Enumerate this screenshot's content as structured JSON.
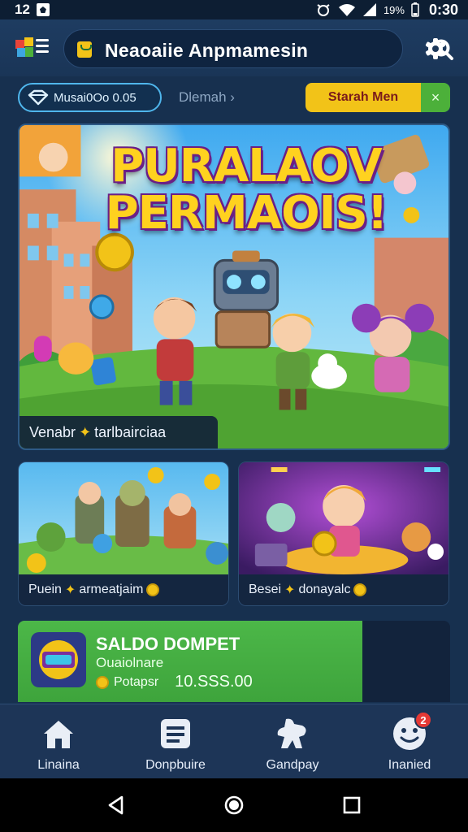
{
  "status_bar": {
    "left_text": "12",
    "battery_text": "19%",
    "time": "0:30"
  },
  "header": {
    "title": "Neaoaiie Anpmamesin"
  },
  "chips": {
    "primary_label": "Musai0Oo 0.05",
    "secondary_label": "Dlemah ›",
    "cta_label": "Starah Men",
    "cta_close": "×"
  },
  "hero": {
    "title_line1": "PURALAOV",
    "title_line2": "PERMAOIS!",
    "caption_prefix": "Venabr",
    "caption_suffix": "tarlbairciaa"
  },
  "cards": [
    {
      "prefix": "Puein",
      "suffix": "armeatjaim"
    },
    {
      "prefix": "Besei",
      "suffix": "donayalc"
    }
  ],
  "wallet": {
    "title": "SALDO DOMPET",
    "subtitle": "Ouaiolnare",
    "balance_label": "Potapsr",
    "balance_value": "10.SSS.00",
    "colors": {
      "green": "#46ad42"
    }
  },
  "bottom_nav": [
    {
      "label": "Linaina",
      "icon": "home-icon"
    },
    {
      "label": "Donpbuire",
      "icon": "document-icon"
    },
    {
      "label": "Gandpay",
      "icon": "puzzle-icon"
    },
    {
      "label": "Inanied",
      "icon": "profile-icon",
      "badge": "2"
    }
  ],
  "colors": {
    "background": "#17304f",
    "accent_yellow": "#f2c318",
    "accent_blue": "#4fb6ec"
  }
}
